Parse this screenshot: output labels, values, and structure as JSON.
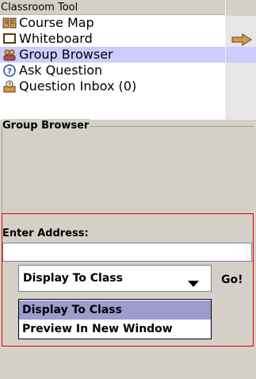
{
  "header": {
    "title": "Classroom Tool"
  },
  "tools": [
    {
      "label": "Course Map",
      "icon": "book-icon"
    },
    {
      "label": "Whiteboard",
      "icon": "whiteboard-icon"
    },
    {
      "label": "Group Browser",
      "icon": "group-icon",
      "selected": true
    },
    {
      "label": "Ask Question",
      "icon": "question-icon"
    },
    {
      "label": "Question Inbox (0)",
      "icon": "inbox-icon"
    }
  ],
  "panel": {
    "title": "Group Browser",
    "address_label": "Enter Address:",
    "address_value": "",
    "display_select": {
      "selected": "Display To Class",
      "options": [
        "Display To Class",
        "Preview In New Window"
      ]
    },
    "go_label": "Go!"
  },
  "colors": {
    "background": "#d4d0c8",
    "selected_row": "#ccccff",
    "dropdown_highlight": "#9c9ccd",
    "red_outline": "#e00000",
    "arrow": "#d49a52"
  }
}
